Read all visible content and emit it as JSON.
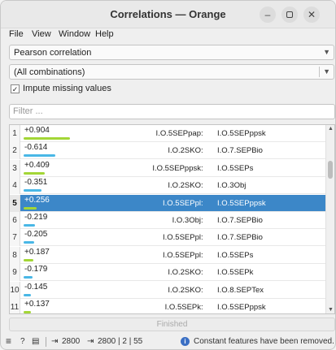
{
  "window": {
    "title": "Correlations — Orange"
  },
  "menu": {
    "file": "File",
    "view": "View",
    "window": "Window",
    "help": "Help"
  },
  "controls": {
    "correlation_type": "Pearson correlation",
    "feature_filter": "(All combinations)",
    "impute_label": "Impute missing values",
    "impute_checked": true,
    "filter_placeholder": "Filter ..."
  },
  "rows": [
    {
      "n": "1",
      "score": "+0.904",
      "a1": "I.O.5SEPpap",
      "a2": "I.O.5SEPppsk",
      "strength": 0.904,
      "color": "#a3d636"
    },
    {
      "n": "2",
      "score": "-0.614",
      "a1": "I.O.2SKO",
      "a2": "I.O.7.SEPBio",
      "strength": 0.614,
      "color": "#49b7e6"
    },
    {
      "n": "3",
      "score": "+0.409",
      "a1": "I.O.5SEPppsk",
      "a2": "I.O.5SEPs",
      "strength": 0.409,
      "color": "#a3d636"
    },
    {
      "n": "4",
      "score": "-0.351",
      "a1": "I.O.2SKO",
      "a2": "I.O.3Obj",
      "strength": 0.351,
      "color": "#49b7e6"
    },
    {
      "n": "5",
      "score": "+0.256",
      "a1": "I.O.5SEPpl",
      "a2": "I.O.5SEPppsk",
      "strength": 0.256,
      "color": "#a3d636",
      "selected": true
    },
    {
      "n": "6",
      "score": "-0.219",
      "a1": "I.O.3Obj",
      "a2": "I.O.7.SEPBio",
      "strength": 0.219,
      "color": "#49b7e6"
    },
    {
      "n": "7",
      "score": "-0.205",
      "a1": "I.O.5SEPpl",
      "a2": "I.O.7.SEPBio",
      "strength": 0.205,
      "color": "#49b7e6"
    },
    {
      "n": "8",
      "score": "+0.187",
      "a1": "I.O.5SEPpl",
      "a2": "I.O.5SEPs",
      "strength": 0.187,
      "color": "#a3d636"
    },
    {
      "n": "9",
      "score": "-0.179",
      "a1": "I.O.2SKO",
      "a2": "I.O.5SEPk",
      "strength": 0.179,
      "color": "#49b7e6"
    },
    {
      "n": "10",
      "score": "-0.145",
      "a1": "I.O.2SKO",
      "a2": "I.O.8.SEPTex",
      "strength": 0.145,
      "color": "#49b7e6"
    },
    {
      "n": "11",
      "score": "+0.137",
      "a1": "I.O.5SEPk",
      "a2": "I.O.5SEPppsk",
      "strength": 0.137,
      "color": "#a3d636"
    }
  ],
  "separator": ":",
  "progress": {
    "label": "Finished"
  },
  "status": {
    "input_count": "2800",
    "output_count": "2800 | 2 | 55",
    "message": "Constant features have been removed."
  }
}
